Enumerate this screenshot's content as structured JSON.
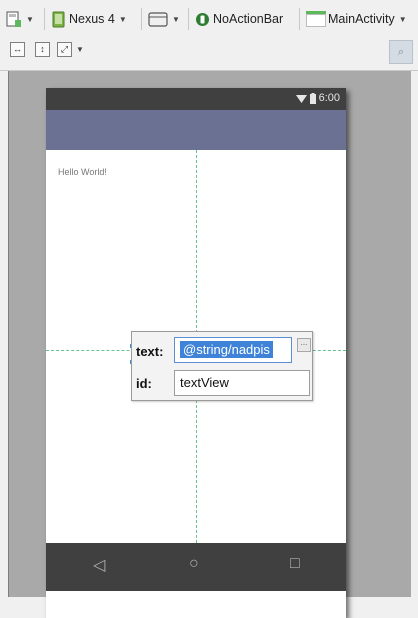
{
  "toolbar": {
    "device": "Nexus 4",
    "theme": "NoActionBar",
    "activity": "MainActivity",
    "theme_color": "#2e7d32"
  },
  "phone": {
    "status_time": "6:00",
    "hello_text": "Hello World!",
    "actionbar_color": "#6b7193",
    "nav_back_glyph": "◁",
    "nav_home_glyph": "○",
    "nav_recent_glyph": "□"
  },
  "property_popup": {
    "text_label": "text:",
    "text_value": "@string/nadpis",
    "id_label": "id:",
    "id_value": "textView",
    "more_label": "..."
  },
  "icons": [
    "design-mode-icon",
    "device-icon",
    "orientation-icon",
    "theme-icon",
    "activity-icon",
    "fit-width-icon",
    "fit-height-icon",
    "expand-icon",
    "zoom-icon"
  ]
}
